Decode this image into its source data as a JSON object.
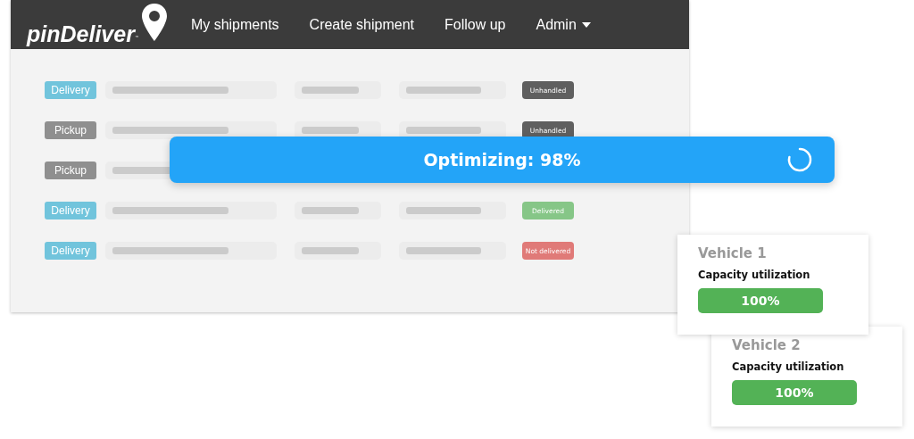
{
  "logo": {
    "text": "pinDeliver",
    "mark": "™"
  },
  "nav": [
    {
      "label": "My shipments",
      "dropdown": false
    },
    {
      "label": "Create shipment",
      "dropdown": false
    },
    {
      "label": "Follow up",
      "dropdown": false
    },
    {
      "label": "Admin",
      "dropdown": true
    }
  ],
  "shipments": [
    {
      "type": {
        "kind": "delivery",
        "label": "Delivery"
      },
      "status": {
        "kind": "unhandled",
        "label": "Unhandled"
      },
      "covered": false
    },
    {
      "type": {
        "kind": "pickup",
        "label": "Pickup"
      },
      "status": {
        "kind": "unhandled",
        "label": "Unhandled"
      },
      "covered": false
    },
    {
      "type": {
        "kind": "pickup",
        "label": "Pickup"
      },
      "covered": true
    },
    {
      "type": {
        "kind": "delivery",
        "label": "Delivery"
      },
      "status": {
        "kind": "delivered",
        "label": "Delivered"
      },
      "covered": false
    },
    {
      "type": {
        "kind": "delivery",
        "label": "Delivery"
      },
      "status": {
        "kind": "not_delivered",
        "label": "Not delivered"
      },
      "covered": false
    }
  ],
  "optimizing": {
    "text": "Optimizing: 98%"
  },
  "vehicles": [
    {
      "title": "Vehicle 1",
      "metric": "Capacity utilization",
      "reading": "100%"
    },
    {
      "title": "Vehicle 2",
      "metric": "Capacity utilization",
      "reading": "100%"
    }
  ]
}
